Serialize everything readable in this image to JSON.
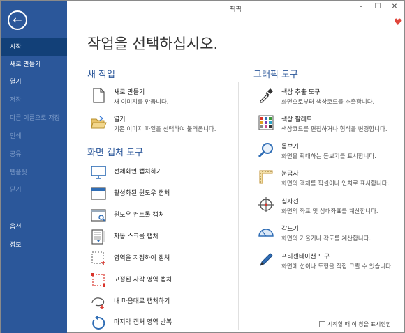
{
  "window": {
    "title": "픽픽",
    "minimize": "–",
    "maximize": "☐",
    "close": "✕"
  },
  "sidebar": {
    "back": "←",
    "items": [
      {
        "label": "시작",
        "active": true,
        "enabled": true
      },
      {
        "label": "새로 만들기",
        "enabled": true
      },
      {
        "label": "열기",
        "enabled": true
      },
      {
        "label": "저장",
        "enabled": false
      },
      {
        "label": "다른 이름으로 저장",
        "enabled": false
      },
      {
        "label": "인쇄",
        "enabled": false
      },
      {
        "label": "공유",
        "enabled": false
      },
      {
        "label": "템플릿",
        "enabled": false
      },
      {
        "label": "닫기",
        "enabled": false
      },
      {
        "label": "옵션",
        "enabled": true
      },
      {
        "label": "정보",
        "enabled": true
      }
    ]
  },
  "main": {
    "title": "작업을 선택하십시오.",
    "new_task": {
      "heading": "새 작업",
      "items": [
        {
          "title": "새로 만들기",
          "desc": "새 이미지를 만듭니다."
        },
        {
          "title": "열기",
          "desc": "기존 이미지 파일을 선택하여 불러옵니다."
        }
      ]
    },
    "capture": {
      "heading": "화면 캡처 도구",
      "items": [
        {
          "title": "전체화면 캡처하기"
        },
        {
          "title": "활성화된 윈도우 캡처"
        },
        {
          "title": "윈도우 컨트롤 캡처"
        },
        {
          "title": "자동 스크롤 캡처"
        },
        {
          "title": "영역을 지정하여 캡처"
        },
        {
          "title": "고정된 사각 영역 캡처"
        },
        {
          "title": "내 마음대로 캡처하기"
        },
        {
          "title": "마지막 캡처 영역 반복"
        }
      ]
    },
    "graphic": {
      "heading": "그래픽 도구",
      "items": [
        {
          "title": "색상 추출 도구",
          "desc": "화면으로부터 색상코드를 추출합니다."
        },
        {
          "title": "색상 팔레트",
          "desc": "색상코드를 편집하거나 형식을 변경합니다."
        },
        {
          "title": "돋보기",
          "desc": "화면을 확대하는 돋보기를 표시합니다."
        },
        {
          "title": "눈금자",
          "desc": "화면의 객체를 픽셀이나 인치로 표시합니다."
        },
        {
          "title": "십자선",
          "desc": "화면의 좌표 및 상대좌표를 계산합니다."
        },
        {
          "title": "각도기",
          "desc": "화면의 기울기나 각도를 계산합니다."
        },
        {
          "title": "프리젠테이션 도구",
          "desc": "화면에 선이나 도형을 직접 그릴 수 있습니다."
        }
      ]
    },
    "footer_checkbox": "시작할 때 이 창을 표시안함"
  }
}
